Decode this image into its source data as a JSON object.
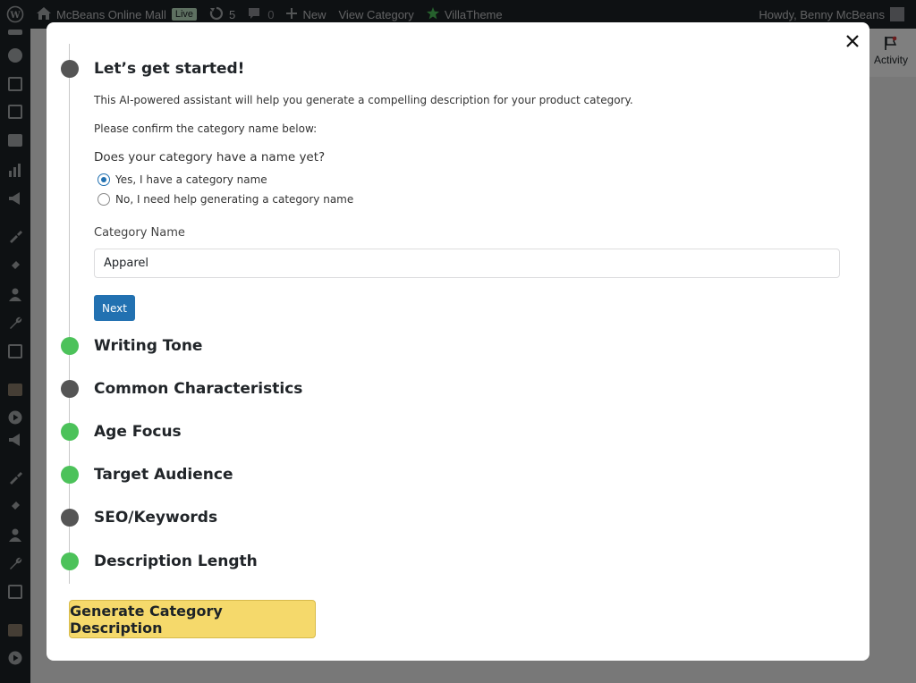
{
  "admin_bar": {
    "site_name": "McBeans Online Mall",
    "live_badge": "Live",
    "updates_count": "5",
    "comments_count": "0",
    "new_label": "New",
    "view_category_label": "View Category",
    "villatheme_label": "VillaTheme",
    "greeting": "Howdy, Benny McBeans"
  },
  "activity": {
    "label": "Activity"
  },
  "modal": {
    "step1": {
      "title": "Let’s get started!",
      "intro": "This AI-powered assistant will help you generate a compelling description for your product category.",
      "confirm_text": "Please confirm the category name below:",
      "question": "Does your category have a name yet?",
      "option_yes": "Yes, I have a category name",
      "option_no": "No, I need help generating a category name",
      "selected_option": "yes",
      "field_label": "Category Name",
      "field_value": "Apparel",
      "next_label": "Next"
    },
    "steps": [
      {
        "title": "Writing Tone",
        "status": "complete"
      },
      {
        "title": "Common Characteristics",
        "status": "pending"
      },
      {
        "title": "Age Focus",
        "status": "complete"
      },
      {
        "title": "Target Audience",
        "status": "complete"
      },
      {
        "title": "SEO/Keywords",
        "status": "pending"
      },
      {
        "title": "Description Length",
        "status": "complete"
      }
    ],
    "generate_label": "Generate Category Description"
  },
  "colors": {
    "step_complete": "#4cc25a",
    "step_pending": "#555555",
    "primary_button": "#2271b1",
    "generate_button": "#f5d96b"
  }
}
